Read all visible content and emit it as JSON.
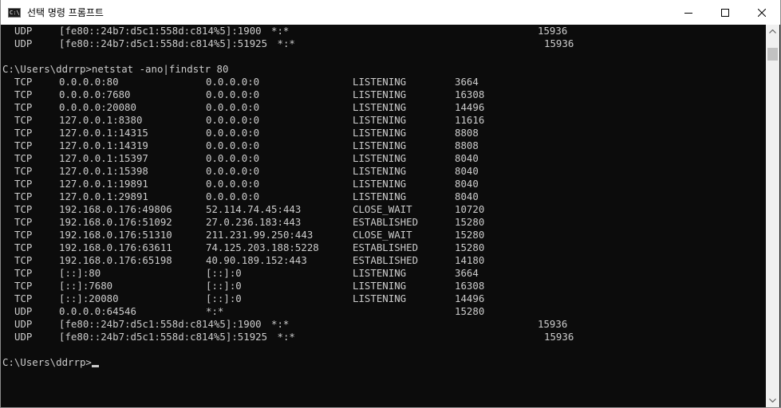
{
  "window": {
    "title": "선택 명령 프롬프트",
    "icon_label": "C:\\",
    "controls": [
      "minimize",
      "maximize",
      "close"
    ]
  },
  "console": {
    "top_rows": [
      {
        "proto": "UDP",
        "local": "[fe80::24b7:d5c1:558d:c814%5]:1900",
        "foreign": "*:*",
        "state": "",
        "pid": "15936"
      },
      {
        "proto": "UDP",
        "local": "[fe80::24b7:d5c1:558d:c814%5]:51925",
        "foreign": "*:*",
        "state": "",
        "pid": "15936"
      }
    ],
    "command_line": "C:\\Users\\ddrrp>netstat -ano|findstr 80",
    "rows": [
      {
        "proto": "TCP",
        "local": "0.0.0.0:80",
        "foreign": "0.0.0.0:0",
        "state": "LISTENING",
        "pid": "3664"
      },
      {
        "proto": "TCP",
        "local": "0.0.0.0:7680",
        "foreign": "0.0.0.0:0",
        "state": "LISTENING",
        "pid": "16308"
      },
      {
        "proto": "TCP",
        "local": "0.0.0.0:20080",
        "foreign": "0.0.0.0:0",
        "state": "LISTENING",
        "pid": "14496"
      },
      {
        "proto": "TCP",
        "local": "127.0.0.1:8380",
        "foreign": "0.0.0.0:0",
        "state": "LISTENING",
        "pid": "11616"
      },
      {
        "proto": "TCP",
        "local": "127.0.0.1:14315",
        "foreign": "0.0.0.0:0",
        "state": "LISTENING",
        "pid": "8808"
      },
      {
        "proto": "TCP",
        "local": "127.0.0.1:14319",
        "foreign": "0.0.0.0:0",
        "state": "LISTENING",
        "pid": "8808"
      },
      {
        "proto": "TCP",
        "local": "127.0.0.1:15397",
        "foreign": "0.0.0.0:0",
        "state": "LISTENING",
        "pid": "8040"
      },
      {
        "proto": "TCP",
        "local": "127.0.0.1:15398",
        "foreign": "0.0.0.0:0",
        "state": "LISTENING",
        "pid": "8040"
      },
      {
        "proto": "TCP",
        "local": "127.0.0.1:19891",
        "foreign": "0.0.0.0:0",
        "state": "LISTENING",
        "pid": "8040"
      },
      {
        "proto": "TCP",
        "local": "127.0.0.1:29891",
        "foreign": "0.0.0.0:0",
        "state": "LISTENING",
        "pid": "8040"
      },
      {
        "proto": "TCP",
        "local": "192.168.0.176:49806",
        "foreign": "52.114.74.45:443",
        "state": "CLOSE_WAIT",
        "pid": "10720"
      },
      {
        "proto": "TCP",
        "local": "192.168.0.176:51092",
        "foreign": "27.0.236.183:443",
        "state": "ESTABLISHED",
        "pid": "15280"
      },
      {
        "proto": "TCP",
        "local": "192.168.0.176:51310",
        "foreign": "211.231.99.250:443",
        "state": "CLOSE_WAIT",
        "pid": "15280"
      },
      {
        "proto": "TCP",
        "local": "192.168.0.176:63611",
        "foreign": "74.125.203.188:5228",
        "state": "ESTABLISHED",
        "pid": "15280"
      },
      {
        "proto": "TCP",
        "local": "192.168.0.176:65198",
        "foreign": "40.90.189.152:443",
        "state": "ESTABLISHED",
        "pid": "14180"
      },
      {
        "proto": "TCP",
        "local": "[::]:80",
        "foreign": "[::]:0",
        "state": "LISTENING",
        "pid": "3664"
      },
      {
        "proto": "TCP",
        "local": "[::]:7680",
        "foreign": "[::]:0",
        "state": "LISTENING",
        "pid": "16308"
      },
      {
        "proto": "TCP",
        "local": "[::]:20080",
        "foreign": "[::]:0",
        "state": "LISTENING",
        "pid": "14496"
      },
      {
        "proto": "UDP",
        "local": "0.0.0.0:64546",
        "foreign": "*:*",
        "state": "",
        "pid": "15280"
      },
      {
        "proto": "UDP",
        "local": "[fe80::24b7:d5c1:558d:c814%5]:1900",
        "foreign": "*:*",
        "state": "",
        "pid": "15936"
      },
      {
        "proto": "UDP",
        "local": "[fe80::24b7:d5c1:558d:c814%5]:51925",
        "foreign": "*:*",
        "state": "",
        "pid": "15936"
      }
    ],
    "prompt": "C:\\Users\\ddrrp>"
  },
  "colors": {
    "console_bg": "#0c0c0c",
    "console_fg": "#cccccc",
    "titlebar_bg": "#ffffff"
  }
}
